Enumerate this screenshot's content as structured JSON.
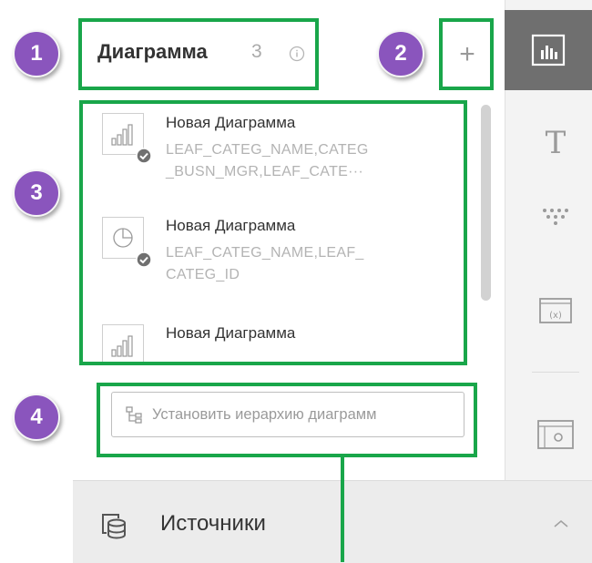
{
  "header": {
    "title": "Диаграмма",
    "count": "3"
  },
  "charts": [
    {
      "title": "Новая Диаграмма",
      "fields": "LEAF_CATEG_NAME,CATEG _BUSN_MGR,LEAF_CATE···",
      "icon": "bar-chart-icon"
    },
    {
      "title": "Новая Диаграмма",
      "fields": "LEAF_CATEG_NAME,LEAF_ CATEG_ID",
      "icon": "pie-chart-icon"
    },
    {
      "title": "Новая Диаграмма",
      "fields": "",
      "icon": "bar-chart-icon"
    }
  ],
  "hierarchy_button": {
    "label": "Установить иерархию диаграмм"
  },
  "sources": {
    "label": "Источники"
  },
  "annotations": {
    "n1": "1",
    "n2": "2",
    "n3": "3",
    "n4": "4"
  },
  "colors": {
    "accent_green": "#19a64a",
    "badge_purple": "#8a55bd",
    "active_tab": "#6f6f6f"
  }
}
